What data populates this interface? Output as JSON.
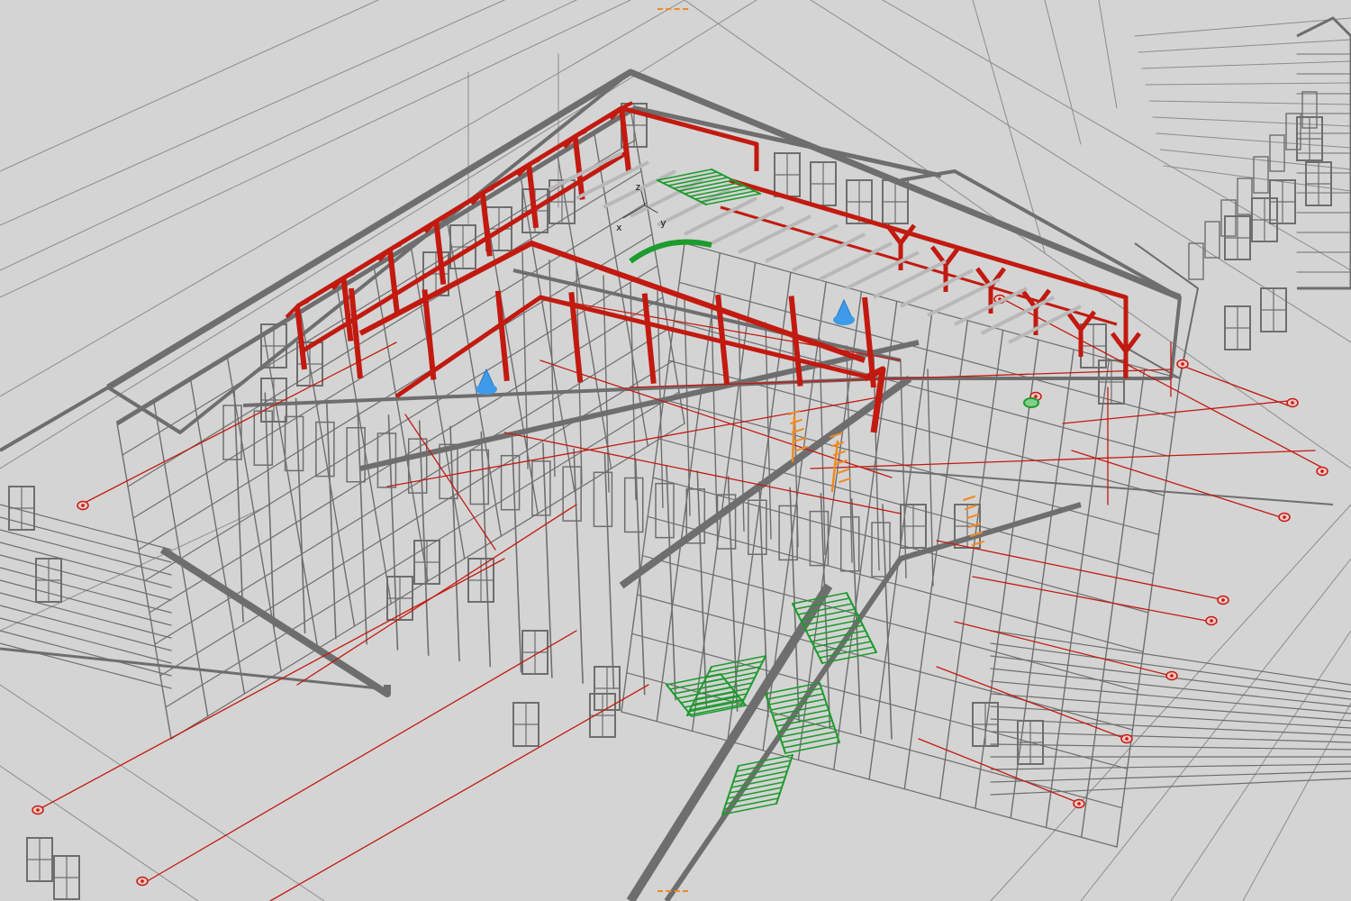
{
  "viewport": {
    "background": "#d4d4d4",
    "wire_color": "#6e6e6e",
    "light_wire_color": "#8c8c8c",
    "selected_color": "#c21a10",
    "stair_color": "#1e9b2e",
    "camera_color": "#3d9be9",
    "accent_color": "#f08a24"
  },
  "gizmo": {
    "x_label": "x",
    "y_label": "y",
    "z_label": "z"
  },
  "objects": {
    "building": "building-wireframe-icon",
    "roof_trusses": "roof-truss-icon",
    "stairs": "stair-icon",
    "lights": "light-icon",
    "cameras": "camera-icon",
    "helpers": "helper-icon"
  }
}
